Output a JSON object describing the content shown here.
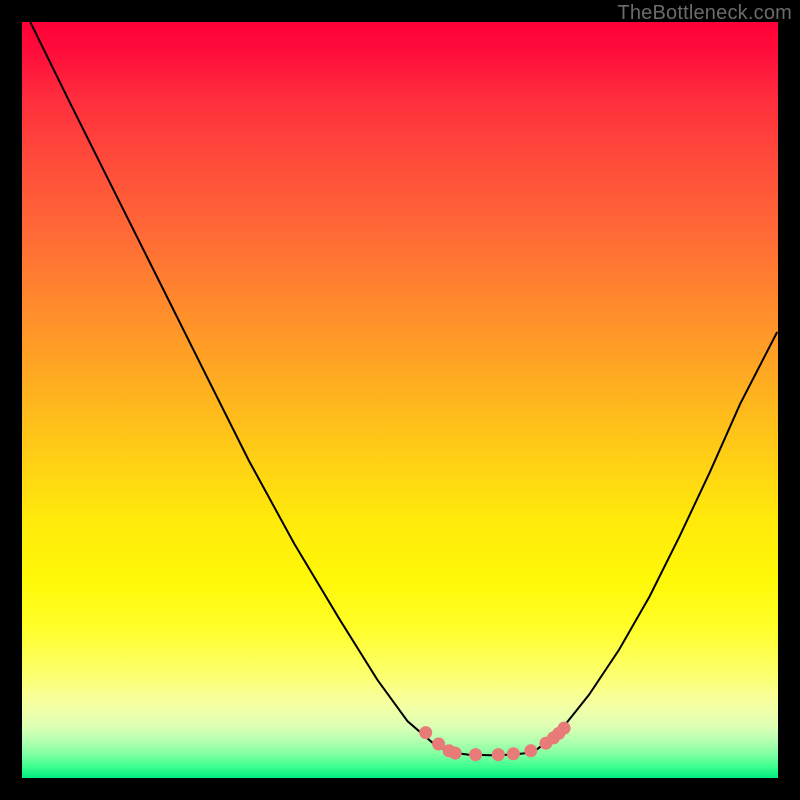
{
  "watermark": "TheBottleneck.com",
  "colors": {
    "frame_border": "#000000",
    "marker": "#e87a77",
    "curve": "#000000"
  },
  "chart_data": {
    "type": "line",
    "title": "",
    "xlabel": "",
    "ylabel": "",
    "xlim": [
      0,
      100
    ],
    "ylim": [
      0,
      100
    ],
    "grid": false,
    "legend": false,
    "note": "Chart has no visible axis ticks or numeric labels; values are normalized 0–100 estimates from pixel positions inside the plotting rectangle (origin bottom-left).",
    "series": [
      {
        "name": "left-curve",
        "x": [
          1.1,
          6.0,
          12.0,
          18.0,
          24.0,
          30.0,
          36.0,
          42.0,
          47.0,
          51.0,
          54.5,
          56.6
        ],
        "y": [
          100.0,
          90.0,
          78.0,
          66.0,
          54.0,
          42.0,
          31.0,
          21.0,
          13.0,
          7.5,
          4.5,
          3.4
        ]
      },
      {
        "name": "flat-bottom",
        "x": [
          56.6,
          59.0,
          62.0,
          65.0,
          67.6
        ],
        "y": [
          3.4,
          3.1,
          3.0,
          3.1,
          3.4
        ]
      },
      {
        "name": "right-curve",
        "x": [
          67.6,
          71.0,
          75.0,
          79.0,
          83.0,
          87.0,
          91.0,
          95.0,
          99.9
        ],
        "y": [
          3.4,
          6.0,
          11.0,
          17.0,
          24.0,
          32.0,
          40.5,
          49.5,
          59.0
        ]
      }
    ],
    "markers": {
      "name": "salmon-dots",
      "x": [
        53.4,
        55.1,
        56.5,
        57.3,
        60.0,
        63.0,
        65.0,
        67.3,
        69.3,
        70.3,
        71.0,
        71.7
      ],
      "y": [
        6.0,
        4.5,
        3.6,
        3.3,
        3.1,
        3.1,
        3.2,
        3.6,
        4.6,
        5.3,
        5.9,
        6.6
      ]
    }
  }
}
